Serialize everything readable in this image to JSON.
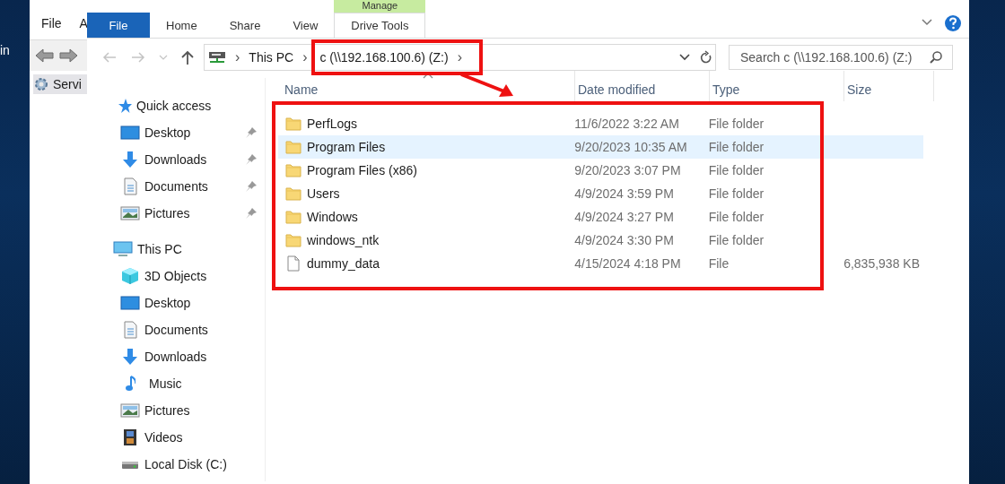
{
  "desktop": {
    "label": "in"
  },
  "back_window": {
    "menu": [
      "File",
      "A"
    ],
    "tree_item": "Servi"
  },
  "window": {
    "context_group": "Manage",
    "tabs": [
      {
        "label": "File",
        "kind": "file"
      },
      {
        "label": "Home",
        "kind": "plain"
      },
      {
        "label": "Share",
        "kind": "plain"
      },
      {
        "label": "View",
        "kind": "plain"
      },
      {
        "label": "Drive Tools",
        "kind": "context"
      }
    ]
  },
  "address": {
    "crumbs": [
      "This PC",
      "c (\\\\192.168.100.6) (Z:)"
    ],
    "separators": [
      "›",
      "›",
      "›"
    ]
  },
  "search": {
    "placeholder": "Search c (\\\\192.168.100.6) (Z:)"
  },
  "nav": [
    {
      "label": "Quick access",
      "kind": "star",
      "children": [
        {
          "label": "Desktop",
          "kind": "desktop",
          "pinned": true
        },
        {
          "label": "Downloads",
          "kind": "download",
          "pinned": true
        },
        {
          "label": "Documents",
          "kind": "document",
          "pinned": true
        },
        {
          "label": "Pictures",
          "kind": "picture",
          "pinned": true
        }
      ]
    },
    {
      "label": "This PC",
      "kind": "pc",
      "children": [
        {
          "label": "3D Objects",
          "kind": "cube",
          "pinned": false
        },
        {
          "label": "Desktop",
          "kind": "desktop",
          "pinned": false
        },
        {
          "label": "Documents",
          "kind": "document",
          "pinned": false
        },
        {
          "label": "Downloads",
          "kind": "download",
          "pinned": false
        },
        {
          "label": "Music",
          "kind": "music",
          "pinned": false
        },
        {
          "label": "Pictures",
          "kind": "picture",
          "pinned": false
        },
        {
          "label": "Videos",
          "kind": "video",
          "pinned": false
        },
        {
          "label": "Local Disk (C:)",
          "kind": "disk",
          "pinned": false
        }
      ]
    }
  ],
  "columns": [
    {
      "label": "Name",
      "sorted": true
    },
    {
      "label": "Date modified",
      "sorted": false
    },
    {
      "label": "Type",
      "sorted": false
    },
    {
      "label": "Size",
      "sorted": false
    }
  ],
  "rows": [
    {
      "name": "PerfLogs",
      "date": "11/6/2022 3:22 AM",
      "type": "File folder",
      "kind": "folder",
      "selected": false
    },
    {
      "name": "Program Files",
      "date": "9/20/2023 10:35 AM",
      "type": "File folder",
      "kind": "folder",
      "selected": true
    },
    {
      "name": "Program Files (x86)",
      "date": "9/20/2023 3:07 PM",
      "type": "File folder",
      "kind": "folder",
      "selected": false
    },
    {
      "name": "Users",
      "date": "4/9/2024 3:59 PM",
      "type": "File folder",
      "kind": "folder",
      "selected": false
    },
    {
      "name": "Windows",
      "date": "4/9/2024 3:27 PM",
      "type": "File folder",
      "kind": "folder",
      "selected": false
    },
    {
      "name": "windows_ntk",
      "date": "4/9/2024 3:30 PM",
      "type": "File folder",
      "kind": "folder",
      "selected": false
    },
    {
      "name": "dummy_data",
      "date": "4/15/2024 4:18 PM",
      "type": "File",
      "size": "6,835,938 KB",
      "kind": "file",
      "selected": false
    }
  ]
}
